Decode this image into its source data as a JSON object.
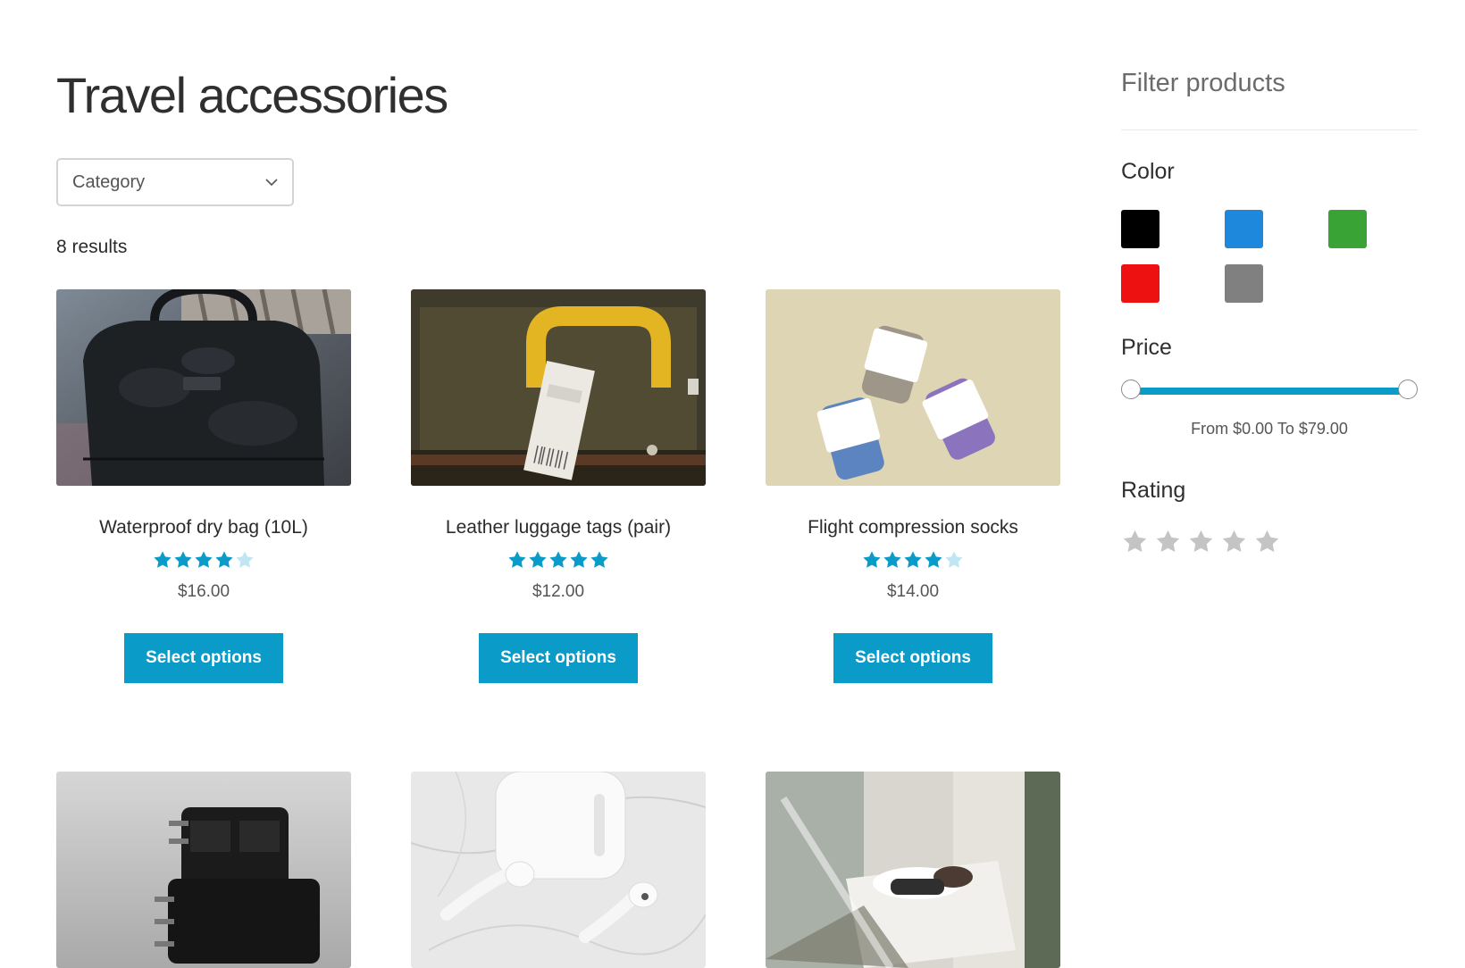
{
  "page": {
    "title": "Travel accessories",
    "category_select": {
      "selected": "Category"
    },
    "results_count": "8 results"
  },
  "products": [
    {
      "name": "Waterproof dry bag (10L)",
      "rating": 4,
      "price": "$16.00",
      "button": "Select options",
      "image": "black-camo-backpack"
    },
    {
      "name": "Leather luggage tags (pair)",
      "rating": 5,
      "price": "$12.00",
      "button": "Select options",
      "image": "luggage-tag-on-handle"
    },
    {
      "name": "Flight compression socks",
      "rating": 4,
      "price": "$14.00",
      "button": "Select options",
      "image": "folded-socks"
    },
    {
      "name": "",
      "image": "travel-adapters"
    },
    {
      "name": "",
      "image": "wireless-earbuds"
    },
    {
      "name": "",
      "image": "sleeping-traveler"
    }
  ],
  "sidebar": {
    "title": "Filter products",
    "color_filter": {
      "heading": "Color",
      "swatches": [
        {
          "name": "black",
          "hex": "#000000"
        },
        {
          "name": "blue",
          "hex": "#1e88dc"
        },
        {
          "name": "green",
          "hex": "#3aa335"
        },
        {
          "name": "red",
          "hex": "#ee1111"
        },
        {
          "name": "gray",
          "hex": "#808080"
        }
      ]
    },
    "price_filter": {
      "heading": "Price",
      "min": 0,
      "max": 79,
      "range_text": "From $0.00 To $79.00"
    },
    "rating_filter": {
      "heading": "Rating",
      "max_stars": 5
    }
  },
  "colors": {
    "accent": "#0a9bc8",
    "star_filled": "#0a9bc8",
    "star_empty": "#bfe6f2",
    "sidebar_star": "#c4c4c4"
  }
}
